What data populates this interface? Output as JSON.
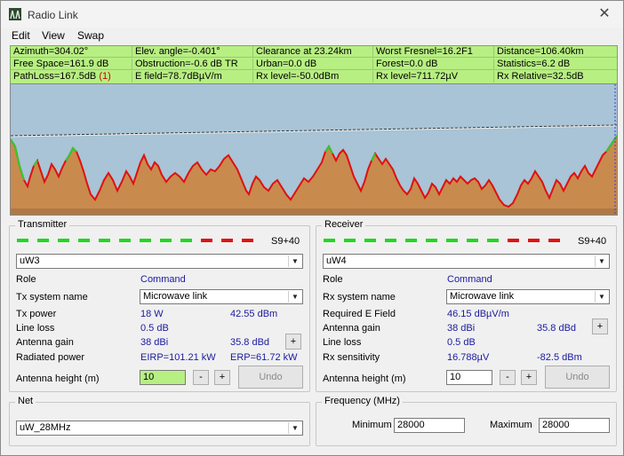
{
  "window": {
    "title": "Radio Link",
    "close_glyph": "✕",
    "icon": "radio-mobile-icon"
  },
  "menu": [
    "Edit",
    "View",
    "Swap"
  ],
  "stats": [
    [
      "Azimuth=304.02°",
      "Elev. angle=-0.401°",
      "Clearance at 23.24km",
      "Worst Fresnel=16.2F1",
      "Distance=106.40km"
    ],
    [
      "Free Space=161.9 dB",
      "Obstruction=-0.6 dB TR",
      "Urban=0.0 dB",
      "Forest=0.0 dB",
      "Statistics=6.2 dB"
    ],
    [
      "PathLoss=167.5dB",
      "E field=78.7dBµV/m",
      "Rx level=-50.0dBm",
      "Rx level=711.72µV",
      "Rx Relative=32.5dB"
    ]
  ],
  "pathloss_flag": "(1)",
  "colors": {
    "stats_bg": "#b7ef82",
    "sky": "#a8c4d6",
    "terrain": "#c98a4e",
    "terrain_line": "#e01010",
    "los_line": "#2ea12e",
    "label_blue": "#1a1aa0",
    "meter_green": "#1fd81f",
    "meter_red": "#e01010"
  },
  "transmitter": {
    "title": "Transmitter",
    "meter_label": "S9+40",
    "meter": {
      "green_segments": 12,
      "red_segments": 3
    },
    "unit": "uW3",
    "role_label": "Role",
    "role_value": "Command",
    "system_label": "Tx system name",
    "system_value": "Microwave link",
    "power_label": "Tx power",
    "power_w": "18 W",
    "power_dbm": "42.55 dBm",
    "lineloss_label": "Line loss",
    "lineloss_value": "0.5 dB",
    "gain_label": "Antenna gain",
    "gain_dbi": "38 dBi",
    "gain_dbd": "35.8 dBd",
    "plus": "+",
    "radiated_label": "Radiated power",
    "eirp": "EIRP=101.21 kW",
    "erp": "ERP=61.72 kW",
    "height_label": "Antenna height (m)",
    "height_value": "10",
    "minus": "-",
    "undo": "Undo"
  },
  "receiver": {
    "title": "Receiver",
    "meter_label": "S9+40",
    "meter": {
      "green_segments": 12,
      "red_segments": 3
    },
    "unit": "uW4",
    "role_label": "Role",
    "role_value": "Command",
    "system_label": "Rx system name",
    "system_value": "Microwave link",
    "efield_label": "Required E Field",
    "efield_value": "46.15 dBµV/m",
    "gain_label": "Antenna gain",
    "gain_dbi": "38 dBi",
    "gain_dbd": "35.8 dBd",
    "plus": "+",
    "lineloss_label": "Line loss",
    "lineloss_value": "0.5 dB",
    "sens_label": "Rx sensitivity",
    "sens_uv": "16.788µV",
    "sens_dbm": "-82.5 dBm",
    "height_label": "Antenna height (m)",
    "height_value": "10",
    "minus": "-",
    "undo": "Undo"
  },
  "net": {
    "title": "Net",
    "value": "uW_28MHz"
  },
  "frequency": {
    "title": "Frequency (MHz)",
    "min_label": "Minimum",
    "min_value": "28000",
    "max_label": "Maximum",
    "max_value": "28000"
  }
}
